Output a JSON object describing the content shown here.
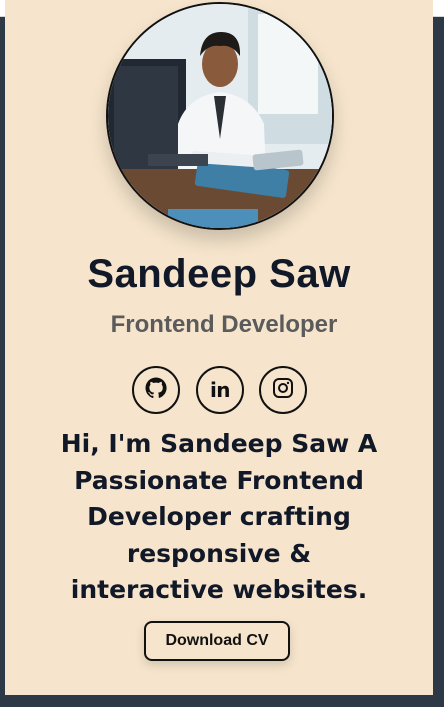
{
  "profile": {
    "name": "Sandeep Saw",
    "role": "Frontend Developer",
    "tagline": "Hi, I'm Sandeep Saw A Passionate Frontend Developer crafting responsive & interactive websites.",
    "download_label": "Download CV"
  },
  "socials": {
    "github_icon": "github-icon",
    "linkedin_label": "in",
    "instagram_icon": "instagram-icon"
  },
  "colors": {
    "card_background": "#f6e5cc",
    "page_background": "#2e3947",
    "heading_text": "#111827",
    "role_text": "#5b5b5b"
  }
}
